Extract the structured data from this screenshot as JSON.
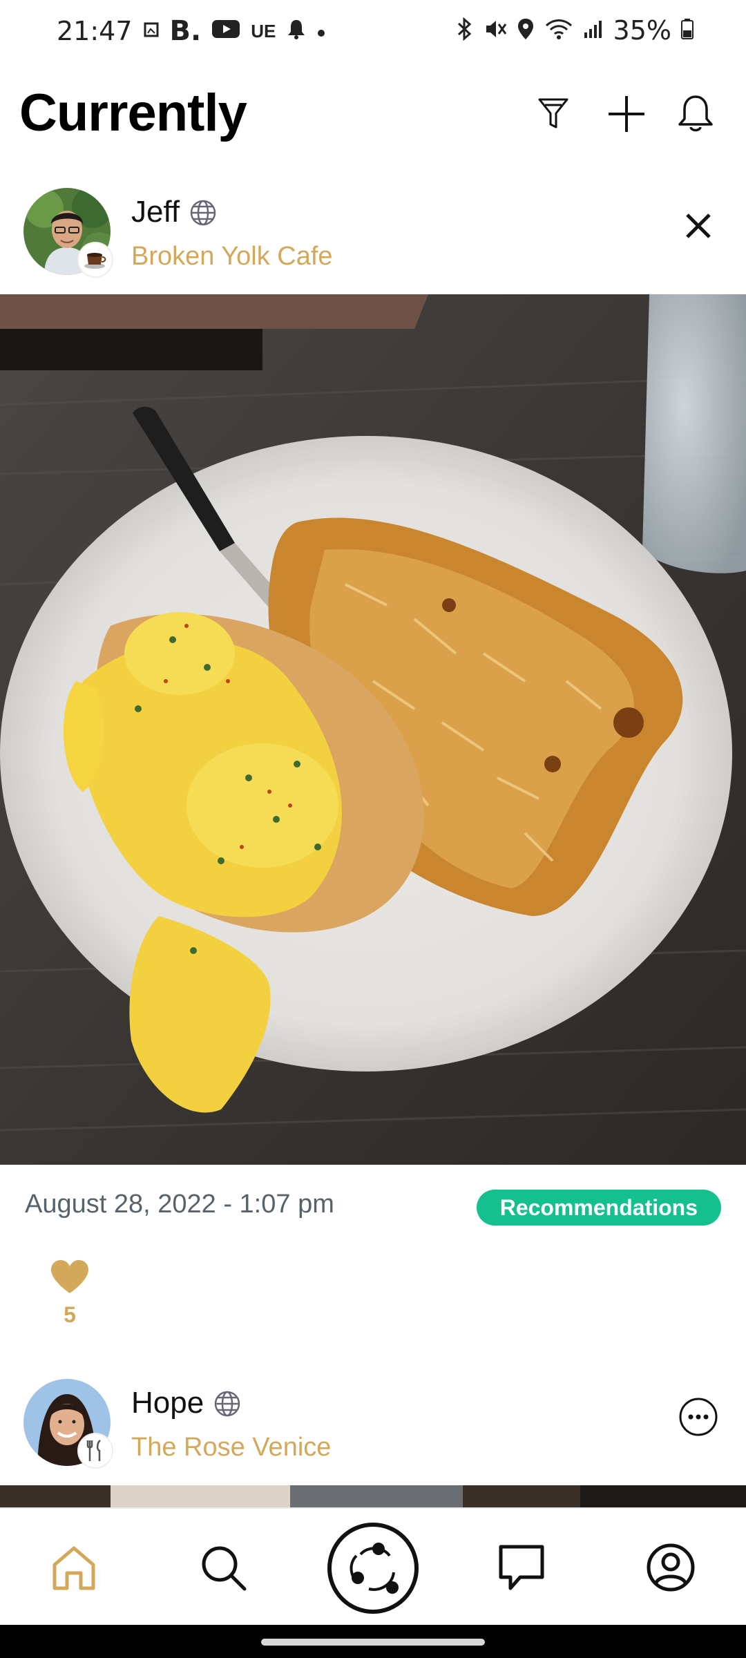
{
  "status_bar": {
    "time": "21:47",
    "left_icons": [
      "gallery-icon",
      "b-app-icon",
      "youtube-icon",
      "ue-icon",
      "bell-icon",
      "dot-icon"
    ],
    "right_icons": [
      "bluetooth-icon",
      "mute-icon",
      "location-icon",
      "wifi-icon",
      "signal-icon"
    ],
    "battery": "35%"
  },
  "header": {
    "title": "Currently",
    "icons": [
      "filter-icon",
      "plus-icon",
      "bell-icon"
    ]
  },
  "posts": [
    {
      "user": "Jeff",
      "place": "Broken Yolk Cafe",
      "badge_icon": "coffee-icon",
      "action_icon": "close-icon",
      "date": "August 28, 2022 - 1:07 pm",
      "tag": "Recommendations",
      "likes": "5"
    },
    {
      "user": "Hope",
      "place": "The Rose Venice",
      "badge_icon": "fork-knife-icon",
      "action_icon": "more-icon"
    }
  ],
  "bottom_nav": [
    "home-icon",
    "search-icon",
    "activity-icon",
    "chat-icon",
    "profile-icon"
  ],
  "colors": {
    "accent_gold": "#d4a85a",
    "tag_green": "#13c08e",
    "date_gray": "#57636b"
  }
}
